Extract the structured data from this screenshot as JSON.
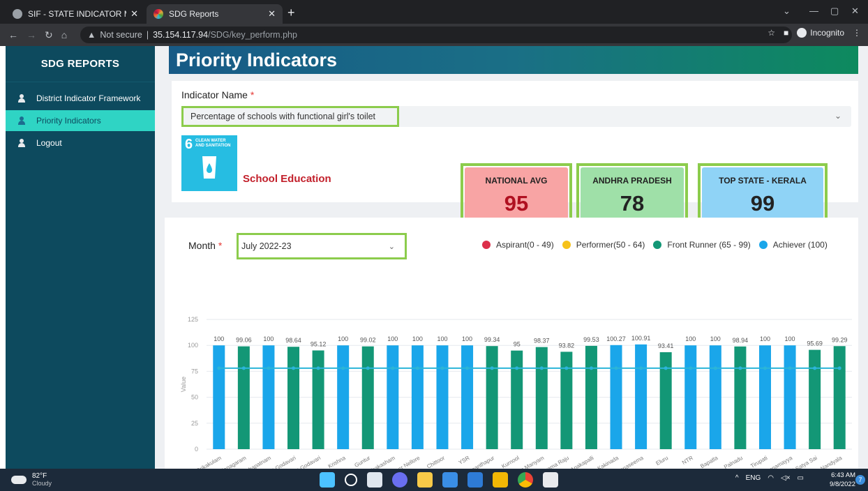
{
  "browser": {
    "tabs": [
      {
        "title": "SIF - STATE INDICATOR MONITOR"
      },
      {
        "title": "SDG Reports"
      }
    ],
    "security_label": "Not secure",
    "url_host": "35.154.117.94",
    "url_path": "/SDG/key_perform.php",
    "profile_label": "Incognito"
  },
  "sidebar": {
    "title": "SDG REPORTS",
    "items": [
      {
        "label": "District Indicator Framework"
      },
      {
        "label": "Priority Indicators"
      },
      {
        "label": "Logout"
      }
    ]
  },
  "page": {
    "title": "Priority Indicators",
    "indicator_label": "Indicator Name",
    "required_mark": "*",
    "indicator_value": "Percentage of schools with functional girl's toilet",
    "sdg_badge": {
      "number": "6",
      "text": "CLEAN WATER AND SANITATION"
    },
    "department": "School Education",
    "stats": [
      {
        "label": "NATIONAL AVG",
        "value": "95",
        "color": "#f8a4a4"
      },
      {
        "label": "ANDHRA PRADESH",
        "value": "78",
        "color": "#9fe0a8"
      },
      {
        "label": "TOP STATE - KERALA",
        "value": "99",
        "color": "#8fd3f6"
      }
    ],
    "month_label": "Month",
    "month_value": "July 2022-23",
    "legend": [
      {
        "label": "Aspirant(0 - 49)",
        "color": "#dc2f4a"
      },
      {
        "label": "Performer(50 - 64)",
        "color": "#f6c21a"
      },
      {
        "label": "Front Runner (65 - 99)",
        "color": "#139776"
      },
      {
        "label": "Achiever (100)",
        "color": "#1aa6ea"
      }
    ]
  },
  "chart_data": {
    "type": "bar",
    "ylabel": "Value",
    "ylim": [
      0,
      125
    ],
    "yticks": [
      0,
      25,
      50,
      75,
      100,
      125
    ],
    "reference_line": 78,
    "categories": [
      "Srikakulam",
      "Vizianagaram",
      "Visakhapatnam",
      "East Godavari",
      "West Godavari",
      "Krishna",
      "Guntur",
      "Prakasham",
      "Spsr Nellore",
      "Chittoor",
      "YSR",
      "Ananthapur",
      "Kurnool",
      "Parvathipuram Manyam",
      "Alluri Seetharama Raju",
      "Anakapalli",
      "Kakinada",
      "Konaseema",
      "Eluru",
      "NTR",
      "Bapatla",
      "Palnadu",
      "Tirupati",
      "Annamayya",
      "Sri Satya Sai",
      "Nandyala"
    ],
    "values": [
      100,
      99.06,
      100,
      98.64,
      95.12,
      100,
      99.02,
      100,
      100,
      100,
      100,
      99.34,
      95,
      98.37,
      93.82,
      99.53,
      100.27,
      100.91,
      93.41,
      100,
      100,
      98.94,
      100,
      100,
      95.69,
      99.29
    ],
    "labels": [
      "100",
      "99.06",
      "100",
      "98.64",
      "95.12",
      "100",
      "99.02",
      "100",
      "100",
      "100",
      "100",
      "99.34",
      "95",
      "98.37",
      "93.82",
      "99.53",
      "100.27",
      "100.91",
      "93.41",
      "100",
      "100",
      "98.94",
      "100",
      "100",
      "95.69",
      "99.29"
    ],
    "achiever_color": "#1aa6ea",
    "front_runner_color": "#139776",
    "line_color": "#2bb5d8"
  },
  "taskbar": {
    "temp": "82°F",
    "weather": "Cloudy",
    "lang": "ENG",
    "time": "6:43 AM",
    "date": "9/8/2022",
    "notifications": "7"
  }
}
